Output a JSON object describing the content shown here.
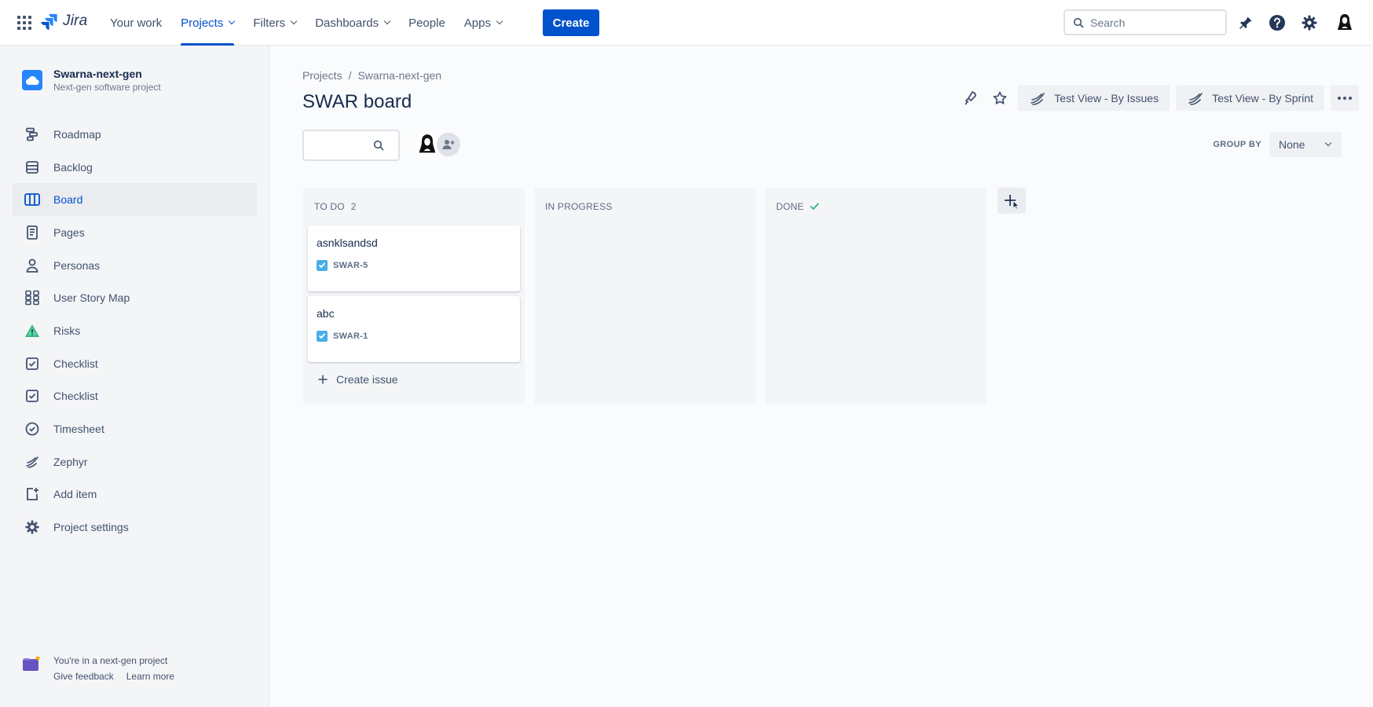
{
  "topnav": {
    "logo_text": "Jira",
    "items": [
      {
        "label": "Your work",
        "has_dropdown": false,
        "active": false
      },
      {
        "label": "Projects",
        "has_dropdown": true,
        "active": true
      },
      {
        "label": "Filters",
        "has_dropdown": true,
        "active": false
      },
      {
        "label": "Dashboards",
        "has_dropdown": true,
        "active": false
      },
      {
        "label": "People",
        "has_dropdown": false,
        "active": false
      },
      {
        "label": "Apps",
        "has_dropdown": true,
        "active": false
      }
    ],
    "create_label": "Create",
    "search_placeholder": "Search",
    "icons": [
      "notifications-icon",
      "help-icon",
      "settings-icon",
      "profile-avatar"
    ]
  },
  "sidebar": {
    "project_name": "Swarna-next-gen",
    "project_type": "Next-gen software project",
    "items": [
      {
        "label": "Roadmap",
        "icon": "roadmap-icon",
        "active": false
      },
      {
        "label": "Backlog",
        "icon": "backlog-icon",
        "active": false
      },
      {
        "label": "Board",
        "icon": "board-icon",
        "active": true
      },
      {
        "label": "Pages",
        "icon": "pages-icon",
        "active": false
      },
      {
        "label": "Personas",
        "icon": "personas-icon",
        "active": false
      },
      {
        "label": "User Story Map",
        "icon": "story-map-icon",
        "active": false
      },
      {
        "label": "Risks",
        "icon": "risks-icon",
        "active": false
      },
      {
        "label": "Checklist",
        "icon": "checklist-icon",
        "active": false
      },
      {
        "label": "Checklist",
        "icon": "checklist-icon",
        "active": false
      },
      {
        "label": "Timesheet",
        "icon": "timesheet-icon",
        "active": false
      },
      {
        "label": "Zephyr",
        "icon": "zephyr-icon",
        "active": false
      },
      {
        "label": "Add item",
        "icon": "add-item-icon",
        "active": false
      },
      {
        "label": "Project settings",
        "icon": "settings-icon",
        "active": false
      }
    ],
    "footer": {
      "text": "You're in a next-gen project",
      "give_feedback": "Give feedback",
      "learn_more": "Learn more"
    }
  },
  "main": {
    "breadcrumb": [
      "Projects",
      "Swarna-next-gen"
    ],
    "breadcrumb_sep": "/",
    "title": "SWAR board",
    "views": [
      "Test View - By Issues",
      "Test View - By Sprint"
    ],
    "group_by_label": "GROUP BY",
    "group_by_value": "None",
    "columns": [
      {
        "name": "TO DO",
        "count": "2",
        "cards": [
          {
            "title": "asnklsandsd",
            "key": "SWAR-5"
          },
          {
            "title": "abc",
            "key": "SWAR-1"
          }
        ],
        "create_issue": "Create issue"
      },
      {
        "name": "IN PROGRESS",
        "count": "",
        "cards": []
      },
      {
        "name": "DONE",
        "count": "",
        "done_check": true,
        "cards": []
      }
    ]
  },
  "colors": {
    "primary": "#0052CC",
    "sidebar_bg": "#F4F5F7",
    "text": "#172B4D",
    "subtle_text": "#6B778C",
    "done_check": "#36B37E",
    "issue_type": "#4BADE8"
  }
}
